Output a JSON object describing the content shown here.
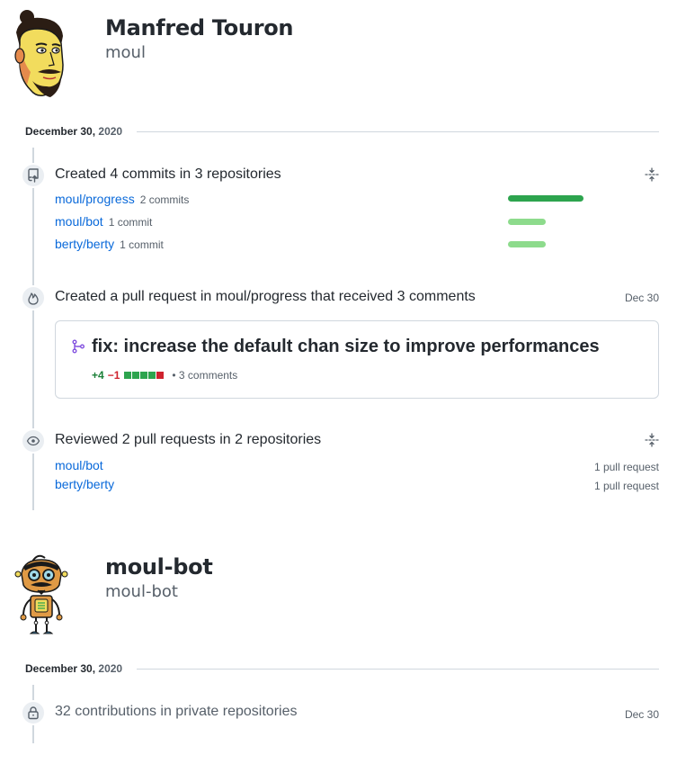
{
  "profiles": [
    {
      "name": "Manfred Touron",
      "login": "moul",
      "date": {
        "day": "December 30,",
        "year": "2020"
      },
      "events": {
        "commits": {
          "title": "Created 4 commits in 3 repositories",
          "icon": "repo-push-icon",
          "repos": [
            {
              "name": "moul/progress",
              "count": "2 commits",
              "share": 1.0
            },
            {
              "name": "moul/bot",
              "count": "1 commit",
              "share": 0.5
            },
            {
              "name": "berty/berty",
              "count": "1 commit",
              "share": 0.5
            }
          ]
        },
        "pull_request": {
          "title": "Created a pull request in moul/progress that received 3 comments",
          "date": "Dec 30",
          "icon": "flame-icon",
          "pr_title": "fix: increase the default chan size to improve performances",
          "additions": "+4",
          "deletions": "−1",
          "comments": "• 3 comments",
          "diffstat": [
            "add",
            "add",
            "add",
            "add",
            "del"
          ]
        },
        "reviews": {
          "title": "Reviewed 2 pull requests in 2 repositories",
          "icon": "eye-icon",
          "repos": [
            {
              "name": "moul/bot",
              "count": "1 pull request"
            },
            {
              "name": "berty/berty",
              "count": "1 pull request"
            }
          ]
        }
      }
    },
    {
      "name": "moul-bot",
      "login": "moul-bot",
      "date": {
        "day": "December 30,",
        "year": "2020"
      },
      "events": {
        "private": {
          "title": "32 contributions in private repositories",
          "date": "Dec 30",
          "icon": "lock-icon"
        }
      }
    }
  ],
  "colors": {
    "link": "#0969da",
    "bar_strong": "#2da44e",
    "bar_light": "#8ddb8c",
    "pr_icon": "#8250df",
    "additions": "#1a7f37",
    "deletions": "#cf222e"
  }
}
